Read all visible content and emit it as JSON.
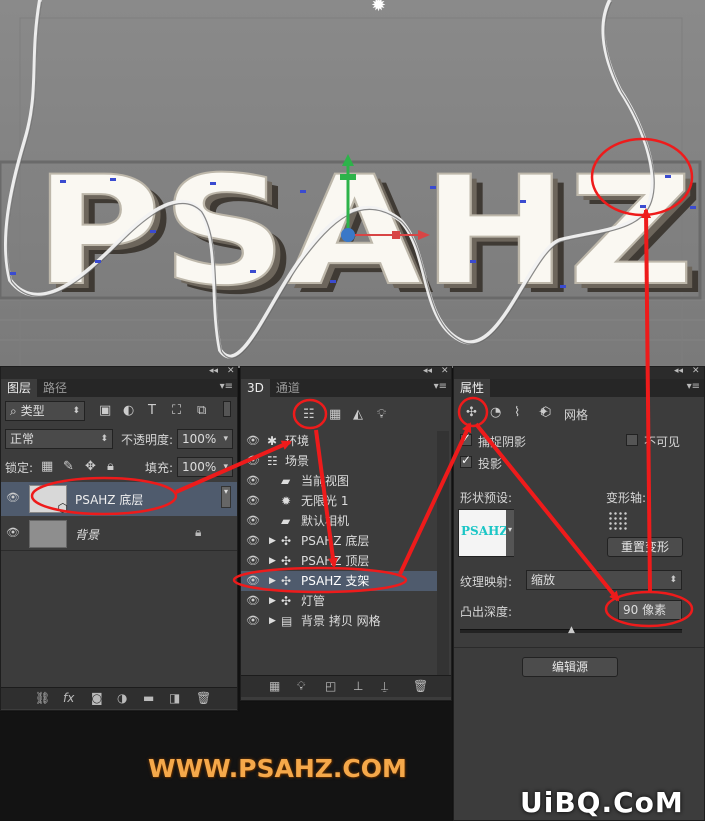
{
  "canvas": {
    "text3d": "PSAHZ",
    "light_icon": "light-sun-icon"
  },
  "layers_panel": {
    "tabs": [
      "图层",
      "路径"
    ],
    "filter_kind": "类型",
    "blend_mode": "正常",
    "opacity_label": "不透明度:",
    "opacity_value": "100%",
    "lock_label": "锁定:",
    "fill_label": "填充:",
    "fill_value": "100%",
    "layers": [
      {
        "name": "PSAHZ 底层",
        "selected": true
      },
      {
        "name": "背景",
        "locked": true
      }
    ],
    "bottom_icons": [
      "link-icon",
      "fx-icon",
      "mask-icon",
      "adjustment-icon",
      "group-icon",
      "new-layer-icon",
      "trash-icon"
    ],
    "bottom_fx": "fx"
  },
  "three_d_panel": {
    "tabs": [
      "3D",
      "通道"
    ],
    "items": [
      {
        "name": "环境",
        "indent": 0,
        "expander": false
      },
      {
        "name": "场景",
        "indent": 0,
        "expander": false
      },
      {
        "name": "当前视图",
        "indent": 1,
        "expander": false
      },
      {
        "name": "无限光 1",
        "indent": 1,
        "expander": false
      },
      {
        "name": "默认相机",
        "indent": 1,
        "expander": false
      },
      {
        "name": "PSAHZ 底层",
        "indent": 1,
        "expander": true
      },
      {
        "name": "PSAHZ 顶层",
        "indent": 1,
        "expander": true
      },
      {
        "name": "PSAHZ 支架",
        "indent": 1,
        "expander": true,
        "selected": true
      },
      {
        "name": "灯管",
        "indent": 1,
        "expander": true
      },
      {
        "name": "背景 拷贝 网格",
        "indent": 1,
        "expander": true
      }
    ]
  },
  "properties_panel": {
    "tabs": [
      "属性"
    ],
    "mode_tab": "网格",
    "catch_shadow": "捕捉阴影",
    "invisible": "不可见",
    "cast_shadow": "投影",
    "shape_preset_label": "形状预设:",
    "shape_preset_preview": "PSAHZ",
    "deform_axis_label": "变形轴:",
    "reset_deform": "重置变形",
    "texture_map_label": "纹理映射:",
    "texture_map_value": "缩放",
    "extrusion_label": "凸出深度:",
    "extrusion_value": "90 像素",
    "edit_source": "编辑源"
  },
  "watermark_psahz": "WWW.PSAHZ.COM",
  "watermark_uibq": "UiBQ.CoM",
  "colors": {
    "annotation_red": "#ee1b1b",
    "watermark_orange": "#f5a84a",
    "panel_bg": "#3c3c3c",
    "selected_row": "#4f5b6d"
  }
}
